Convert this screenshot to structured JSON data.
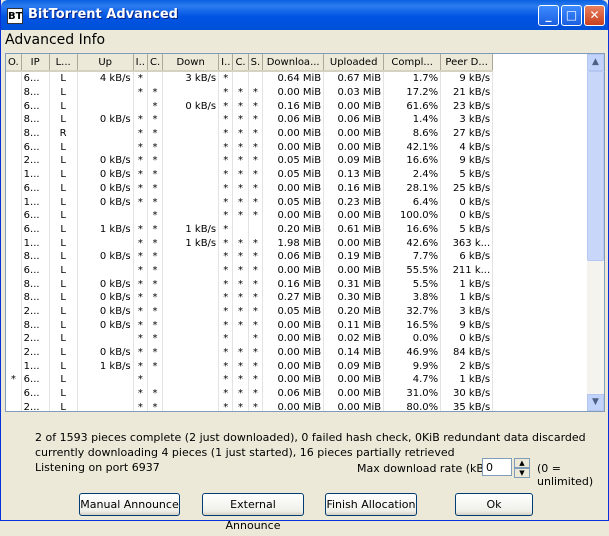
{
  "window": {
    "title": "BitTorrent Advanced",
    "icon_text": "BT",
    "minimize_glyph": "_",
    "maximize_glyph": "□",
    "close_glyph": "✕"
  },
  "heading": "Advanced Info",
  "table": {
    "columns": [
      "O.",
      "IP",
      "L...",
      "Up",
      "I..",
      "C.",
      "Down",
      "I..",
      "C.",
      "S.",
      "Downloa...",
      "Uploaded",
      "Compl...",
      "Peer D..."
    ],
    "rows": [
      [
        "",
        "6...",
        "L",
        "4 kB/s",
        "*",
        "",
        "3 kB/s",
        "*",
        "",
        "",
        "0.64 MiB",
        "0.67 MiB",
        "1.7%",
        "9 kB/s"
      ],
      [
        "",
        "8...",
        "L",
        "",
        "*",
        "*",
        "",
        "*",
        "*",
        "*",
        "0.00 MiB",
        "0.03 MiB",
        "17.2%",
        "21 kB/s"
      ],
      [
        "",
        "6...",
        "L",
        "",
        "",
        "*",
        "0 kB/s",
        "*",
        "*",
        "*",
        "0.16 MiB",
        "0.00 MiB",
        "61.6%",
        "23 kB/s"
      ],
      [
        "",
        "8...",
        "L",
        "0 kB/s",
        "*",
        "*",
        "",
        "*",
        "*",
        "*",
        "0.06 MiB",
        "0.06 MiB",
        "1.4%",
        "3 kB/s"
      ],
      [
        "",
        "8...",
        "R",
        "",
        "*",
        "*",
        "",
        "*",
        "*",
        "*",
        "0.00 MiB",
        "0.00 MiB",
        "8.6%",
        "27 kB/s"
      ],
      [
        "",
        "6...",
        "L",
        "",
        "*",
        "*",
        "",
        "*",
        "*",
        "*",
        "0.00 MiB",
        "0.00 MiB",
        "42.1%",
        "4 kB/s"
      ],
      [
        "",
        "2...",
        "L",
        "0 kB/s",
        "*",
        "*",
        "",
        "*",
        "*",
        "*",
        "0.05 MiB",
        "0.09 MiB",
        "16.6%",
        "9 kB/s"
      ],
      [
        "",
        "1...",
        "L",
        "0 kB/s",
        "*",
        "*",
        "",
        "*",
        "*",
        "*",
        "0.05 MiB",
        "0.13 MiB",
        "2.4%",
        "5 kB/s"
      ],
      [
        "",
        "6...",
        "L",
        "0 kB/s",
        "*",
        "*",
        "",
        "*",
        "*",
        "*",
        "0.00 MiB",
        "0.16 MiB",
        "28.1%",
        "25 kB/s"
      ],
      [
        "",
        "1...",
        "L",
        "0 kB/s",
        "*",
        "*",
        "",
        "*",
        "*",
        "*",
        "0.05 MiB",
        "0.23 MiB",
        "6.4%",
        "0 kB/s"
      ],
      [
        "",
        "6...",
        "L",
        "",
        "",
        "*",
        "",
        "*",
        "*",
        "*",
        "0.00 MiB",
        "0.00 MiB",
        "100.0%",
        "0 kB/s"
      ],
      [
        "",
        "6...",
        "L",
        "1 kB/s",
        "*",
        "*",
        "1 kB/s",
        "*",
        "",
        "",
        "0.20 MiB",
        "0.61 MiB",
        "16.6%",
        "5 kB/s"
      ],
      [
        "",
        "1...",
        "L",
        "",
        "*",
        "*",
        "1 kB/s",
        "*",
        "*",
        "*",
        "1.98 MiB",
        "0.00 MiB",
        "42.6%",
        "363 k..."
      ],
      [
        "",
        "8...",
        "L",
        "0 kB/s",
        "*",
        "*",
        "",
        "*",
        "*",
        "*",
        "0.06 MiB",
        "0.19 MiB",
        "7.7%",
        "6 kB/s"
      ],
      [
        "",
        "6...",
        "L",
        "",
        "*",
        "*",
        "",
        "*",
        "*",
        "*",
        "0.00 MiB",
        "0.00 MiB",
        "55.5%",
        "211 k..."
      ],
      [
        "",
        "8...",
        "L",
        "0 kB/s",
        "*",
        "*",
        "",
        "*",
        "*",
        "*",
        "0.16 MiB",
        "0.31 MiB",
        "5.5%",
        "1 kB/s"
      ],
      [
        "",
        "8...",
        "L",
        "0 kB/s",
        "*",
        "*",
        "",
        "*",
        "*",
        "*",
        "0.27 MiB",
        "0.30 MiB",
        "3.8%",
        "1 kB/s"
      ],
      [
        "",
        "2...",
        "L",
        "0 kB/s",
        "*",
        "*",
        "",
        "*",
        "*",
        "*",
        "0.05 MiB",
        "0.20 MiB",
        "32.7%",
        "3 kB/s"
      ],
      [
        "",
        "8...",
        "L",
        "0 kB/s",
        "*",
        "*",
        "",
        "*",
        "*",
        "*",
        "0.00 MiB",
        "0.11 MiB",
        "16.5%",
        "9 kB/s"
      ],
      [
        "",
        "2...",
        "L",
        "",
        "*",
        "*",
        "",
        "*",
        "",
        "*",
        "0.00 MiB",
        "0.02 MiB",
        "0.0%",
        "0 kB/s"
      ],
      [
        "",
        "2...",
        "L",
        "0 kB/s",
        "*",
        "*",
        "",
        "*",
        "*",
        "*",
        "0.00 MiB",
        "0.14 MiB",
        "46.9%",
        "84 kB/s"
      ],
      [
        "",
        "1...",
        "L",
        "1 kB/s",
        "*",
        "*",
        "",
        "*",
        "*",
        "*",
        "0.00 MiB",
        "0.09 MiB",
        "9.9%",
        "2 kB/s"
      ],
      [
        "*",
        "6...",
        "L",
        "",
        "*",
        "",
        "",
        "*",
        "*",
        "*",
        "0.00 MiB",
        "0.00 MiB",
        "4.7%",
        "1 kB/s"
      ],
      [
        "",
        "6...",
        "L",
        "",
        "*",
        "*",
        "",
        "*",
        "*",
        "*",
        "0.06 MiB",
        "0.00 MiB",
        "31.0%",
        "30 kB/s"
      ],
      [
        "",
        "2...",
        "L",
        "",
        "*",
        "*",
        "",
        "*",
        "*",
        "*",
        "0.00 MiB",
        "0.00 MiB",
        "80.0%",
        "35 kB/s"
      ]
    ]
  },
  "scrollbar": {
    "up_glyph": "▲",
    "down_glyph": "▼"
  },
  "status": {
    "line1": "2 of 1593 pieces complete (2 just downloaded), 0 failed hash check, 0KiB redundant data discarded",
    "line2": "currently downloading 4 pieces (1 just started), 16 pieces partially retrieved",
    "line3": "Listening on port 6937"
  },
  "rate": {
    "label": "Max download rate (kB/s)",
    "value": "0",
    "note": "(0 = unlimited)",
    "up_glyph": "▲",
    "down_glyph": "▼"
  },
  "buttons": {
    "manual": "Manual Announce",
    "external": "External Announce",
    "finish": "Finish Allocation",
    "ok": "Ok"
  }
}
